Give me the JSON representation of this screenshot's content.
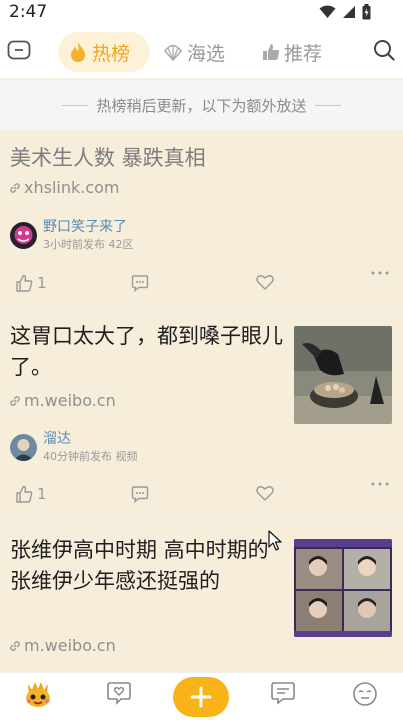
{
  "status_bar": {
    "time": "2:47"
  },
  "top_nav": {
    "tabs": [
      {
        "label": "热榜",
        "active": true
      },
      {
        "label": "海选",
        "active": false
      },
      {
        "label": "推荐",
        "active": false
      }
    ]
  },
  "notice": {
    "text": "热榜稍后更新，以下为额外放送"
  },
  "cards": [
    {
      "title": "美术生人数 暴跌真相",
      "link": "xhslink.com",
      "author": "野口笑子来了",
      "meta": "3小时前发布  42区",
      "likes": "1"
    },
    {
      "title": "这胃口太大了，都到嗓子眼儿了。",
      "link": "m.weibo.cn",
      "author": "溜达",
      "meta": "40分钟前发布  视频",
      "likes": "1"
    },
    {
      "title": "张维伊高中时期   高中时期的张维伊少年感还挺强的",
      "link": "m.weibo.cn"
    }
  ],
  "colors": {
    "accent": "#f8b319",
    "card_bg": "#f6eedb",
    "author": "#5b8bb6"
  }
}
